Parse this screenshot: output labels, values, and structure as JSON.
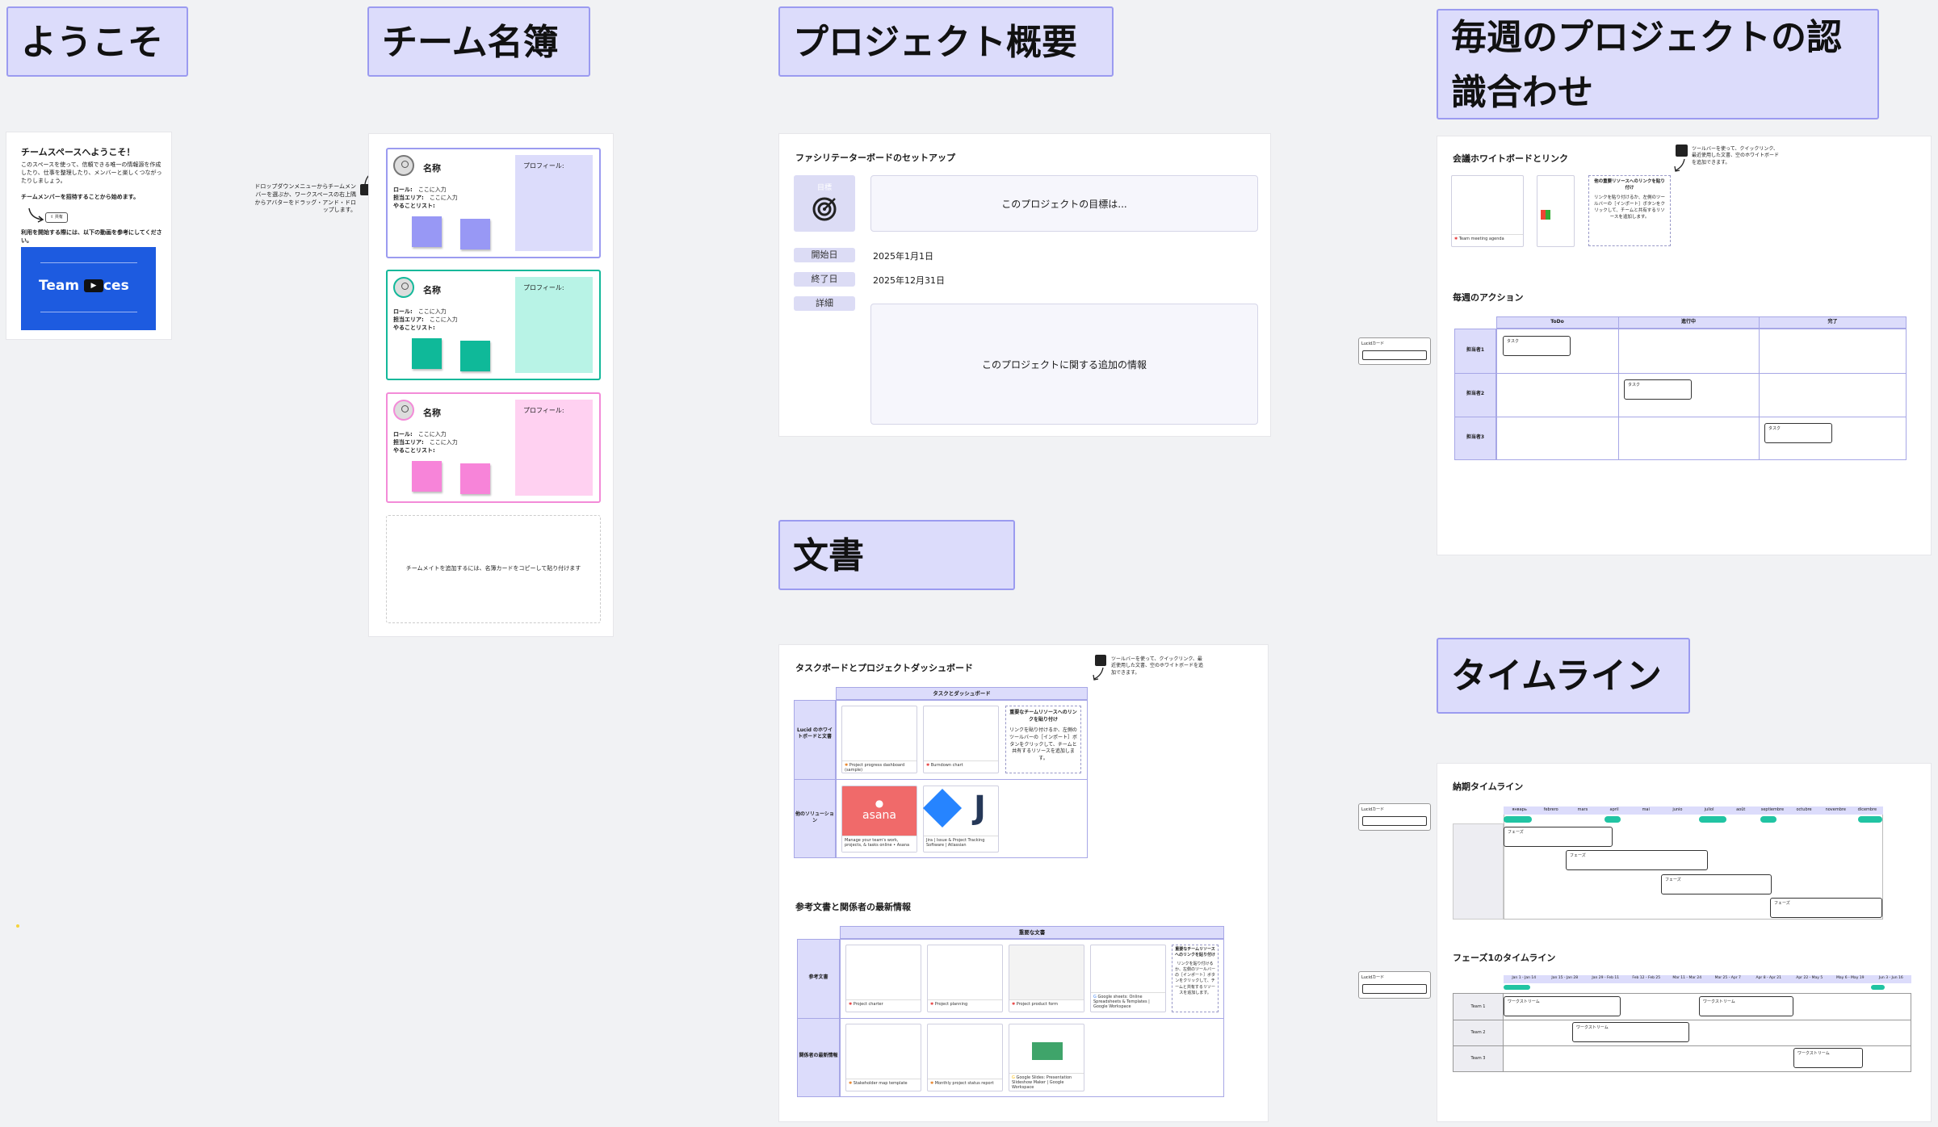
{
  "headers": {
    "welcome": "ようこそ",
    "team_directory": "チーム名簿",
    "project_overview": "プロジェクト概要",
    "weekly_sync": "毎週のプロジェクトの認識合わせ",
    "documents": "文書",
    "timeline": "タイムライン"
  },
  "welcome": {
    "title": "チームスペースへようこそ！",
    "body": "このスペースを使って、信頼できる唯一の情報源を作成したり、仕事を整理したり、メンバーと楽しくつながったりしましょう。",
    "invite": "チームメンバーを招待することから始めます。",
    "share_btn": "共有",
    "start_hint": "利用を開始する際には、以下の動画を参考にしてください。",
    "video_left": "Team",
    "video_right": "ces"
  },
  "team": {
    "hint": "ドロップダウンメニューからチームメンバーを選ぶか、ワークスペースの右上隅からアバターをドラッグ・アンド・ドロップします。",
    "members": [
      {
        "name": "名称",
        "role_label": "ロール:",
        "role": "ここに入力",
        "area_label": "担当エリア:",
        "area": "ここに入力",
        "todo": "やることリスト:",
        "profile": "プロフィール:",
        "color": "#9b9bf0",
        "sticky": "#9898f5",
        "pbg": "#dcdcfb"
      },
      {
        "name": "名称",
        "role_label": "ロール:",
        "role": "ここに入力",
        "area_label": "担当エリア:",
        "area": "ここに入力",
        "todo": "やることリスト:",
        "profile": "プロフィール:",
        "color": "#14b89a",
        "sticky": "#0fb999",
        "pbg": "#b8f3e6"
      },
      {
        "name": "名称",
        "role_label": "ロール:",
        "role": "ここに入力",
        "area_label": "担当エリア:",
        "area": "ここに入力",
        "todo": "やることリスト:",
        "profile": "プロフィール:",
        "color": "#f38bd8",
        "sticky": "#f784d9",
        "pbg": "#ffd1f1"
      }
    ],
    "add_hint": "チームメイトを追加するには、名簿カードをコピーして貼り付けます"
  },
  "overview": {
    "setup": "ファシリテーターボードのセットアップ",
    "goal_label": "目標",
    "goal": "このプロジェクトの目標は...",
    "start_label": "開始日",
    "start": "2025年1月1日",
    "end_label": "終了日",
    "end": "2025年12月31日",
    "detail_label": "詳細",
    "detail": "このプロジェクトに関する追加の情報"
  },
  "weekly": {
    "whiteboard_title": "会議ホワイトボードとリンク",
    "toolbar_tip": "ツールバーを使って、クイックリンク、最近使用した文書、空のホワイトボードを追加できます。",
    "thumb1": "Team meeting agenda",
    "paste_title": "他の重要リソースへのリンクを貼り付け",
    "paste_body": "リンクを貼り付けるか、左側のツールバーの［インポート］ボタンをクリックして、チームと共有するリソースを追加します。",
    "actions_title": "毎週のアクション",
    "cols": [
      "ToDo",
      "進行中",
      "完了"
    ],
    "rows": [
      "担当者1",
      "担当者2",
      "担当者3"
    ],
    "card_label": "タスク"
  },
  "docs": {
    "board_title": "タスクボードとプロジェクトダッシュボード",
    "toolbar_tip": "ツールバーを使って、クイックリンク、最近使用した文書、空のホワイトボードを追加できます。",
    "table_head": "タスクとダッシュボード",
    "row1": "Lucid のホワイトボードと文書",
    "row2": "他のソリューション",
    "thumb_a": "Project progress dashboard (sample)",
    "thumb_b": "Burndown chart",
    "paste_title": "重要なチームリソースへのリンクを貼り付け",
    "paste_body": "リンクを貼り付けるか、左側のツールバーの［インポート］ボタンをクリックして、チームと共有するリソースを追加します。",
    "asana": "asana",
    "asana_cap": "Manage your team's work, projects, & tasks online • Asana",
    "jira_cap": "Jira | Issue & Project Tracking Software | Atlassian",
    "ref_title": "参考文書と関係者の最新情報",
    "ref_head": "重要な文書",
    "ref_row1": "参考文書",
    "ref_row2": "関係者の最新情報",
    "r1": "Project charter",
    "r2": "Project planning",
    "r3": "Project product form",
    "r4": "Google sheets: Online Spreadsheets & Templates | Google Workspace",
    "r5": "Stakeholder map template",
    "r6": "Monthly project status report",
    "r7": "Google Slides: Presentation Slideshow Maker | Google Workspace"
  },
  "timeline": {
    "delivery": "納期タイムライン",
    "phase1": "フェーズ1のタイムライン",
    "months": [
      "январь",
      "febrero",
      "mars",
      "april",
      "mai",
      "junio",
      "juliol",
      "août",
      "septiembre",
      "octubre",
      "novembre",
      "dicembre"
    ],
    "weeks": [
      "Jan 1 - Jan 14",
      "Jan 15 - Jan 28",
      "Jan 29 - Feb 11",
      "Feb 12 - Feb 25",
      "Mar 11 - Mar 24",
      "Mar 25 - Apr 7",
      "Apr 8 - Apr 21",
      "Apr 22 - May 5",
      "May 6 - May 19",
      "Jun 3 - Jun 16"
    ],
    "phase_label": "フェーズ",
    "task_label": "ワークストリーム",
    "rows": [
      "Team 1",
      "Team 2",
      "Team 3"
    ],
    "side_label": "Lucidカード"
  },
  "colors": {
    "accent": "#9b9bf0",
    "teal": "#21c4a3",
    "header_bg": "#dcdcfb"
  }
}
